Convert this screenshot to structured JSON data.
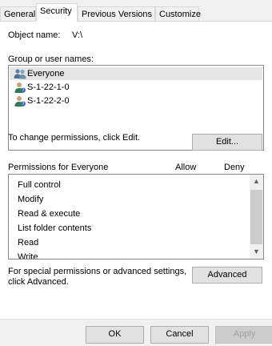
{
  "tabs": [
    {
      "label": "General",
      "active": false
    },
    {
      "label": "Security",
      "active": true
    },
    {
      "label": "Previous Versions",
      "active": false
    },
    {
      "label": "Customize",
      "active": false
    }
  ],
  "object_name": {
    "label": "Object name:",
    "value": "V:\\"
  },
  "group_section": {
    "label": "Group or user names:",
    "users": [
      {
        "name": "Everyone",
        "icon": "user-group-icon",
        "selected": true
      },
      {
        "name": "S-1-22-1-0",
        "icon": "user-icon",
        "selected": false
      },
      {
        "name": "S-1-22-2-0",
        "icon": "user-icon",
        "selected": false
      }
    ]
  },
  "edit_hint": "To change permissions, click Edit.",
  "edit_button": "Edit...",
  "permissions": {
    "header": "Permissions for Everyone",
    "allow_label": "Allow",
    "deny_label": "Deny",
    "items": [
      "Full control",
      "Modify",
      "Read & execute",
      "List folder contents",
      "Read",
      "Write"
    ]
  },
  "advanced_hint_line1": "For special permissions or advanced settings,",
  "advanced_hint_line2": "click Advanced.",
  "advanced_button": "Advanced",
  "footer": {
    "ok": "OK",
    "cancel": "Cancel",
    "apply": "Apply"
  },
  "colors": {
    "selected_row": "#e5e5e5",
    "button_face": "#e1e1e1",
    "panel": "#ffffff",
    "chrome": "#f0f0f0"
  }
}
